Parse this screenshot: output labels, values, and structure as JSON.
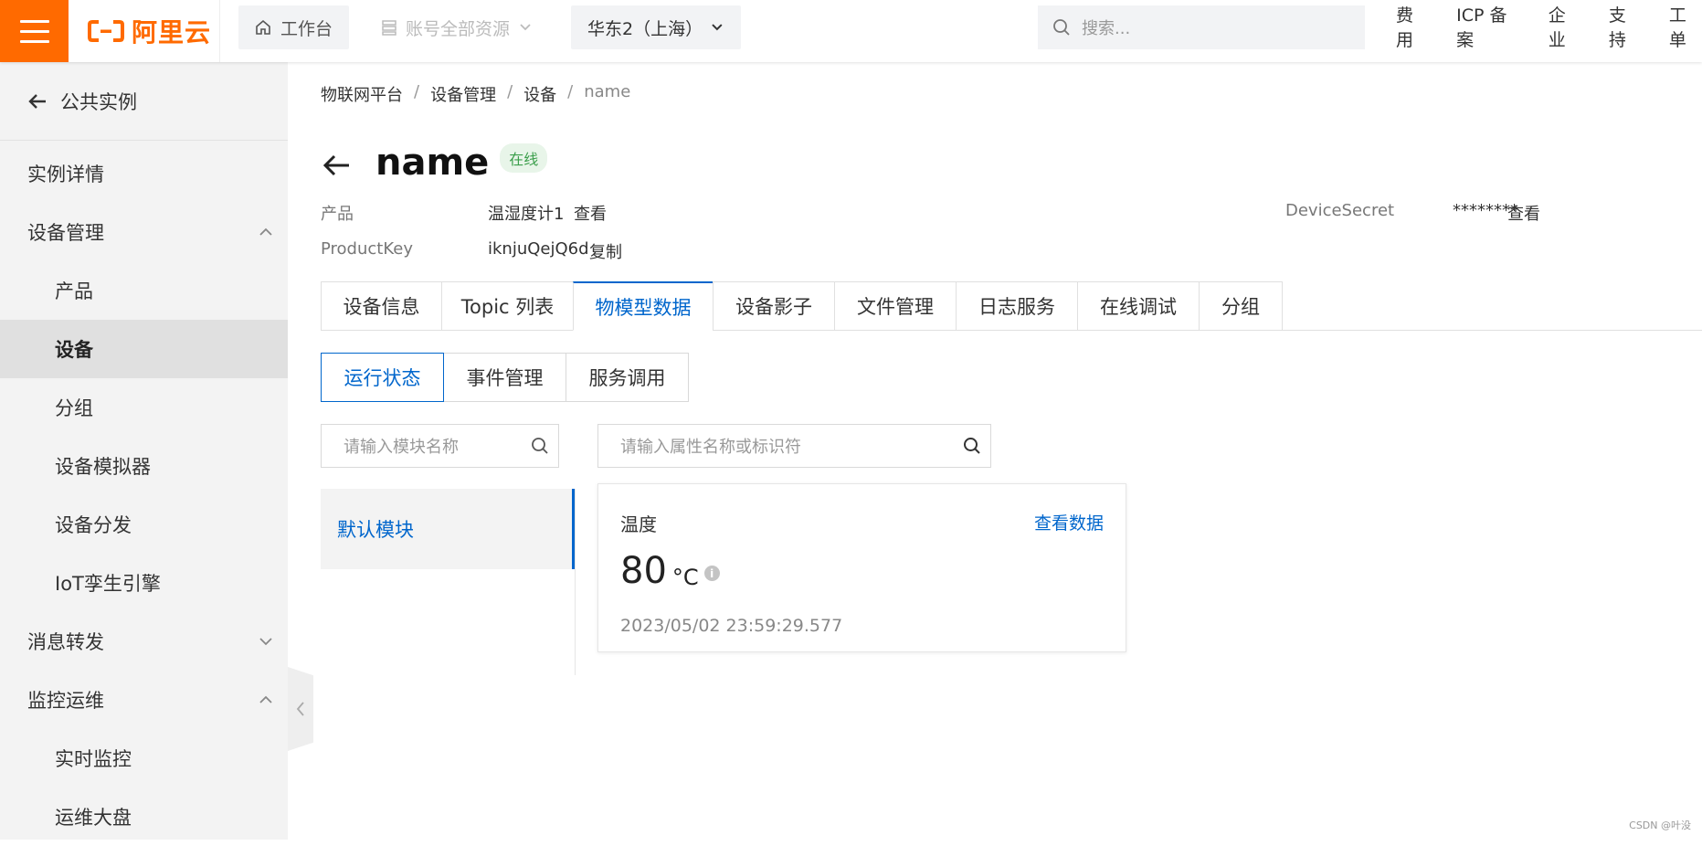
{
  "topbar": {
    "brand": "阿里云",
    "workbench": "工作台",
    "account_resources": "账号全部资源",
    "region": "华东2（上海）",
    "search_placeholder": "搜索...",
    "links": [
      "费用",
      "ICP 备案",
      "企业",
      "支持",
      "工单"
    ]
  },
  "sidebar": {
    "back_label": "公共实例",
    "items": [
      {
        "label": "实例详情",
        "level": 1
      },
      {
        "label": "设备管理",
        "level": 1,
        "expanded": true
      },
      {
        "label": "产品",
        "level": 2
      },
      {
        "label": "设备",
        "level": 2,
        "active": true
      },
      {
        "label": "分组",
        "level": 2
      },
      {
        "label": "设备模拟器",
        "level": 2
      },
      {
        "label": "设备分发",
        "level": 2
      },
      {
        "label": "IoT孪生引擎",
        "level": 2
      },
      {
        "label": "消息转发",
        "level": 1,
        "expanded": false
      },
      {
        "label": "监控运维",
        "level": 1,
        "expanded": true
      },
      {
        "label": "实时监控",
        "level": 2
      },
      {
        "label": "运维大盘",
        "level": 2
      }
    ]
  },
  "breadcrumb": [
    "物联网平台",
    "设备管理",
    "设备",
    "name"
  ],
  "device": {
    "name": "name",
    "status": "在线",
    "product_label": "产品",
    "product_value": "温湿度计1",
    "product_link": "查看",
    "productkey_label": "ProductKey",
    "productkey_value": "iknjuQejQ6d",
    "productkey_link": "复制",
    "secret_label": "DeviceSecret",
    "secret_value": "********",
    "secret_link": "查看"
  },
  "tabs": [
    "设备信息",
    "Topic 列表",
    "物模型数据",
    "设备影子",
    "文件管理",
    "日志服务",
    "在线调试",
    "分组"
  ],
  "active_tab": "物模型数据",
  "subtabs": [
    "运行状态",
    "事件管理",
    "服务调用"
  ],
  "active_subtab": "运行状态",
  "module_search_placeholder": "请输入模块名称",
  "property_search_placeholder": "请输入属性名称或标识符",
  "modules": [
    "默认模块"
  ],
  "property_card": {
    "name": "温度",
    "view_link": "查看数据",
    "value": "80",
    "unit": "°C",
    "timestamp": "2023/05/02 23:59:29.577"
  },
  "watermark": "CSDN @叶没",
  "colors": {
    "brand": "#ff6a00",
    "link": "#0066cc",
    "online": "#3c9f4c"
  }
}
